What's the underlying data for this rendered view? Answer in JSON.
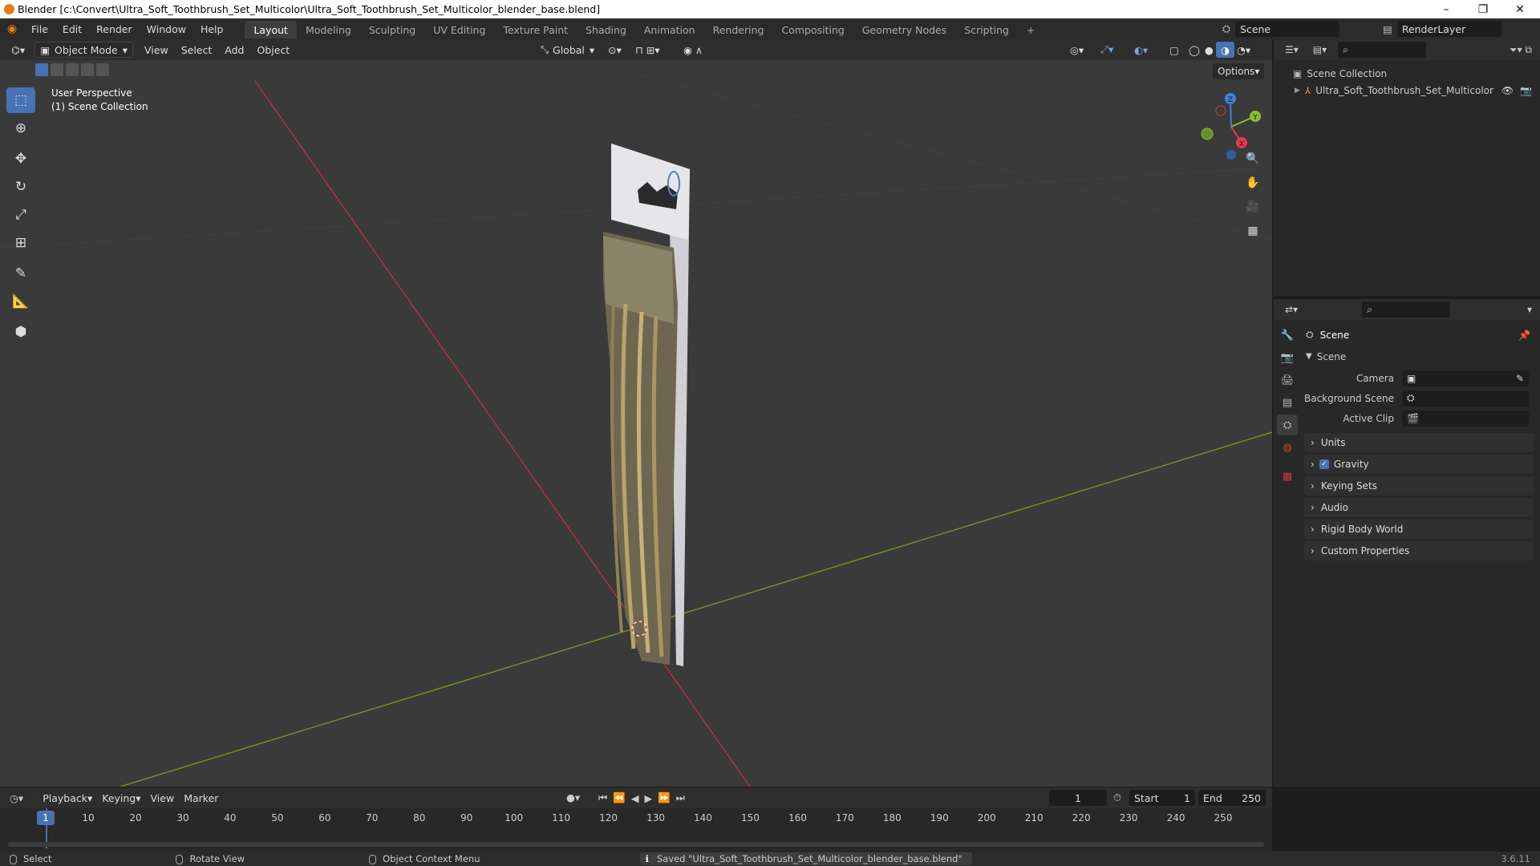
{
  "window": {
    "title": "Blender [c:\\Convert\\Ultra_Soft_Toothbrush_Set_Multicolor\\Ultra_Soft_Toothbrush_Set_Multicolor_blender_base.blend]",
    "minimize": "–",
    "maximize": "❐",
    "close": "✕"
  },
  "menubar": {
    "items": [
      "File",
      "Edit",
      "Render",
      "Window",
      "Help"
    ],
    "workspaces": [
      "Layout",
      "Modeling",
      "Sculpting",
      "UV Editing",
      "Texture Paint",
      "Shading",
      "Animation",
      "Rendering",
      "Compositing",
      "Geometry Nodes",
      "Scripting"
    ],
    "active_workspace": "Layout",
    "add_tab": "+",
    "scene_name": "Scene",
    "view_layer": "RenderLayer"
  },
  "viewport": {
    "mode": "Object Mode",
    "menus": [
      "View",
      "Select",
      "Add",
      "Object"
    ],
    "transform_orientation": "Global",
    "options_label": "Options",
    "info_line1": "User Perspective",
    "info_line2": "(1) Scene Collection",
    "gizmo": {
      "x": "X",
      "y": "Y",
      "z": "Z",
      "x_color": "#e8394f",
      "y_color": "#8cbd2a",
      "z_color": "#3d82d8"
    },
    "tools": [
      "select-box",
      "cursor",
      "move",
      "rotate",
      "scale",
      "transform",
      "annotate",
      "measure",
      "add-cube"
    ],
    "axis_colors": {
      "x_axis": "#b3303f",
      "y_axis": "#6a8f2a"
    }
  },
  "outliner": {
    "root": "Scene Collection",
    "items": [
      {
        "label": "Ultra_Soft_Toothbrush_Set_Multicolor"
      }
    ]
  },
  "properties": {
    "header": "Scene",
    "section_open": "Scene",
    "fields": [
      {
        "label": "Camera",
        "value": ""
      },
      {
        "label": "Background Scene",
        "value": ""
      },
      {
        "label": "Active Clip",
        "value": ""
      }
    ],
    "sections": [
      "Units",
      "Gravity",
      "Keying Sets",
      "Audio",
      "Rigid Body World",
      "Custom Properties"
    ],
    "gravity_checked": true
  },
  "timeline": {
    "menus": [
      "Playback",
      "Keying",
      "View",
      "Marker"
    ],
    "current_frame": "1",
    "start_label": "Start",
    "start_value": "1",
    "end_label": "End",
    "end_value": "250",
    "ruler": [
      "1",
      "10",
      "20",
      "30",
      "40",
      "50",
      "60",
      "70",
      "80",
      "90",
      "100",
      "110",
      "120",
      "130",
      "140",
      "150",
      "160",
      "170",
      "180",
      "190",
      "200",
      "210",
      "220",
      "230",
      "240",
      "250"
    ]
  },
  "statusbar": {
    "select": "Select",
    "rotate": "Rotate View",
    "context": "Object Context Menu",
    "message": "Saved \"Ultra_Soft_Toothbrush_Set_Multicolor_blender_base.blend\"",
    "version": "3.6.11"
  }
}
